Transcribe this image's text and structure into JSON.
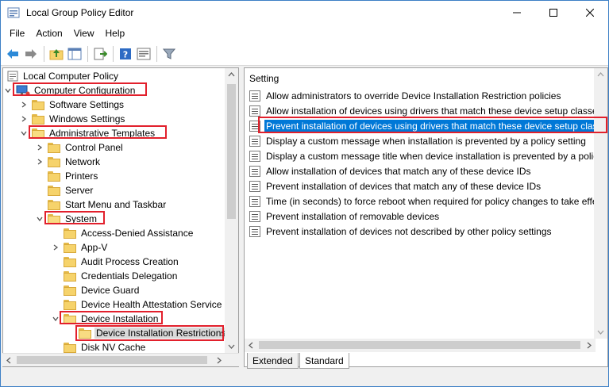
{
  "window": {
    "title": "Local Group Policy Editor"
  },
  "menu": [
    "File",
    "Action",
    "View",
    "Help"
  ],
  "tree": {
    "root": "Local Computer Policy",
    "computer_configuration": "Computer Configuration",
    "software_settings": "Software Settings",
    "windows_settings": "Windows Settings",
    "administrative_templates": "Administrative Templates",
    "control_panel": "Control Panel",
    "network": "Network",
    "printers": "Printers",
    "server": "Server",
    "start_menu": "Start Menu and Taskbar",
    "system": "System",
    "access_denied": "Access-Denied Assistance",
    "app_v": "App-V",
    "audit_process": "Audit Process Creation",
    "credentials_delegation": "Credentials Delegation",
    "device_guard": "Device Guard",
    "device_health": "Device Health Attestation Service",
    "device_installation": "Device Installation",
    "device_installation_restrictions": "Device Installation Restrictions",
    "disk_nv_cache": "Disk NV Cache"
  },
  "settings": {
    "header": "Setting",
    "items": [
      "Allow administrators to override Device Installation Restriction policies",
      "Allow installation of devices using drivers that match these device setup classes",
      "Prevent installation of devices using drivers that match these device setup classes",
      "Display a custom message when installation is prevented by a policy setting",
      "Display a custom message title when device installation is prevented by a policy setting",
      "Allow installation of devices that match any of these device IDs",
      "Prevent installation of devices that match any of these device IDs",
      "Time (in seconds) to force reboot when required for policy changes to take effect",
      "Prevent installation of removable devices",
      "Prevent installation of devices not described by other policy settings"
    ]
  },
  "tabs": {
    "extended": "Extended",
    "standard": "Standard"
  },
  "colors": {
    "selection": "#0078d7",
    "highlight_box": "#e2202c",
    "folder": "#f6d36b"
  }
}
